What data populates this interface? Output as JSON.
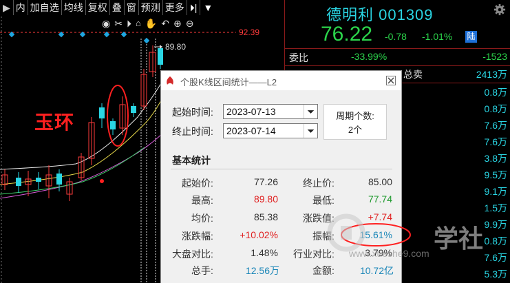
{
  "toolbar": {
    "items": [
      "内",
      "加自选",
      "均线",
      "复权",
      "叠",
      "窗",
      "预测",
      "更多"
    ]
  },
  "chart": {
    "price_high_label": "92.39",
    "peak_label": "89.80",
    "annotation": "玉环"
  },
  "quote": {
    "name_code": "德明利 001309",
    "price": "76.22",
    "change": "-0.78",
    "change_pct": "-1.01%",
    "badge": "陆",
    "weibi_label": "委比",
    "weibi_pct": "-33.99%",
    "weibi_num": "-1523",
    "sell_label": "总卖",
    "sell_value": "2413万",
    "volumes": [
      "0.8万",
      "0.8万",
      "7.6万",
      "7.6万",
      "3.8万",
      "9.5万",
      "9.1万",
      "1.5万",
      "9.9万",
      "0.8万",
      "7.6万",
      "5.3万"
    ]
  },
  "dialog": {
    "title": "个股K线区间统计——L2",
    "start_label": "起始时间:",
    "start_value": "2023-07-13",
    "end_label": "终止时间:",
    "end_value": "2023-07-14",
    "period_label": "周期个数:",
    "period_value": "2个",
    "section_title": "基本统计",
    "stats": {
      "start_price_label": "起始价:",
      "start_price": "77.26",
      "end_price_label": "终止价:",
      "end_price": "85.00",
      "high_label": "最高:",
      "high": "89.80",
      "low_label": "最低:",
      "low": "77.74",
      "avg_label": "均价:",
      "avg": "85.38",
      "change_value_label": "涨跌值:",
      "change_value": "+7.74",
      "change_pct_label": "涨跌幅:",
      "change_pct": "+10.02%",
      "amplitude_label": "振幅:",
      "amplitude": "15.61%",
      "market_ratio_label": "大盘对比:",
      "market_ratio": "1.48%",
      "industry_ratio_label": "行业对比:",
      "industry_ratio": "3.79%",
      "volume_label": "总手:",
      "volume": "12.56万",
      "amount_label": "金额:",
      "amount": "10.72亿"
    }
  },
  "watermark": {
    "url": "www.xueshe9.com",
    "brand": "学社"
  },
  "colors": {
    "up": "#ff3b3b",
    "down": "#2bd44b",
    "cyan": "#2ad6e4",
    "annotation": "#ff2020",
    "divider": "#8b1a1a"
  }
}
